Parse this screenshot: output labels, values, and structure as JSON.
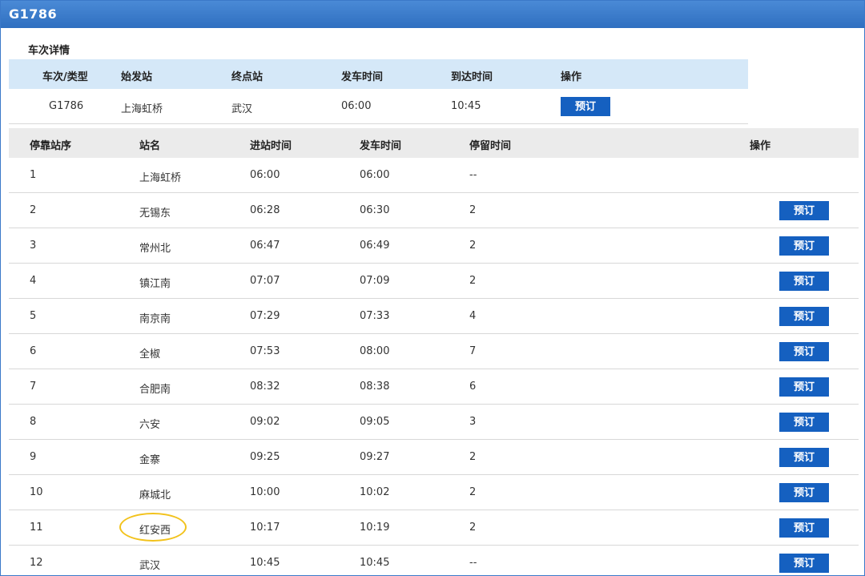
{
  "title": "G1786",
  "detail": {
    "section_title": "车次详情",
    "headers": [
      "车次/类型",
      "始发站",
      "终点站",
      "发车时间",
      "到达时间",
      "操作"
    ],
    "row": {
      "train": "G1786",
      "from": "上海虹桥",
      "to": "武汉",
      "depart": "06:00",
      "arrive": "10:45",
      "action": "预订"
    }
  },
  "stops": {
    "headers": [
      "停靠站序",
      "站名",
      "进站时间",
      "发车时间",
      "停留时间",
      "操作"
    ],
    "book_label": "预订",
    "rows": [
      {
        "seq": "1",
        "station": "上海虹桥",
        "arrive": "06:00",
        "depart": "06:00",
        "stay": "--",
        "bookable": false
      },
      {
        "seq": "2",
        "station": "无锡东",
        "arrive": "06:28",
        "depart": "06:30",
        "stay": "2",
        "bookable": true
      },
      {
        "seq": "3",
        "station": "常州北",
        "arrive": "06:47",
        "depart": "06:49",
        "stay": "2",
        "bookable": true
      },
      {
        "seq": "4",
        "station": "镇江南",
        "arrive": "07:07",
        "depart": "07:09",
        "stay": "2",
        "bookable": true
      },
      {
        "seq": "5",
        "station": "南京南",
        "arrive": "07:29",
        "depart": "07:33",
        "stay": "4",
        "bookable": true
      },
      {
        "seq": "6",
        "station": "全椒",
        "arrive": "07:53",
        "depart": "08:00",
        "stay": "7",
        "bookable": true
      },
      {
        "seq": "7",
        "station": "合肥南",
        "arrive": "08:32",
        "depart": "08:38",
        "stay": "6",
        "bookable": true
      },
      {
        "seq": "8",
        "station": "六安",
        "arrive": "09:02",
        "depart": "09:05",
        "stay": "3",
        "bookable": true
      },
      {
        "seq": "9",
        "station": "金寨",
        "arrive": "09:25",
        "depart": "09:27",
        "stay": "2",
        "bookable": true
      },
      {
        "seq": "10",
        "station": "麻城北",
        "arrive": "10:00",
        "depart": "10:02",
        "stay": "2",
        "bookable": true
      },
      {
        "seq": "11",
        "station": "红安西",
        "arrive": "10:17",
        "depart": "10:19",
        "stay": "2",
        "bookable": true,
        "highlighted": true
      },
      {
        "seq": "12",
        "station": "武汉",
        "arrive": "10:45",
        "depart": "10:45",
        "stay": "--",
        "bookable": true
      }
    ]
  },
  "colors": {
    "header_bar": "#2f6fc0",
    "button": "#1560c0",
    "summary_head": "#d5e8f8",
    "stops_head": "#ebebeb",
    "highlight": "#f2c21b"
  }
}
